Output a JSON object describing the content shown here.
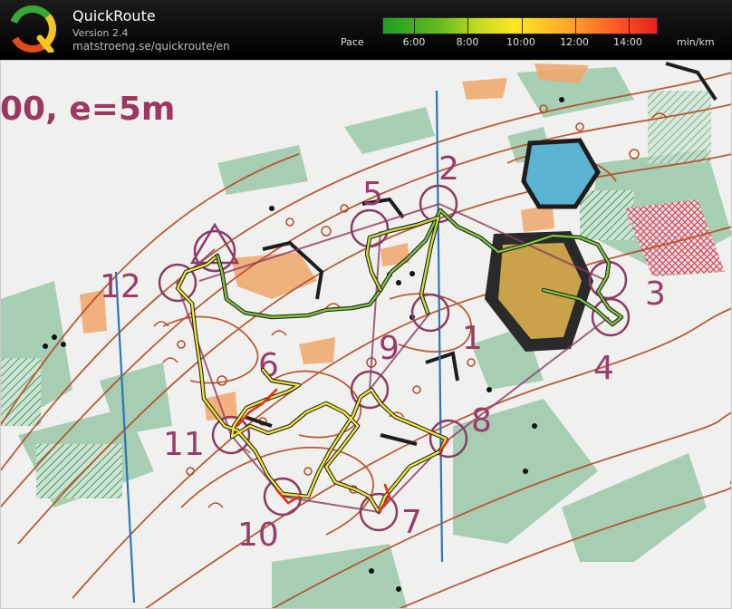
{
  "header": {
    "app_name": "QuickRoute",
    "version": "Version 2.4",
    "url": "matstroeng.se/quickroute/en"
  },
  "pace_legend": {
    "label": "Pace",
    "unit": "min/km",
    "ticks": [
      "6:00",
      "8:00",
      "10:00",
      "12:00",
      "14:00"
    ],
    "colors": {
      "fast": "#1f9c23",
      "medium": "#ffe820",
      "slow": "#e8201c"
    }
  },
  "map": {
    "scale_text": "00, e=5m",
    "controls": [
      {
        "label": "1"
      },
      {
        "label": "2"
      },
      {
        "label": "3"
      },
      {
        "label": "4"
      },
      {
        "label": "5"
      },
      {
        "label": "6"
      },
      {
        "label": "7"
      },
      {
        "label": "8"
      },
      {
        "label": "9"
      },
      {
        "label": "10"
      },
      {
        "label": "11"
      },
      {
        "label": "12"
      }
    ]
  }
}
